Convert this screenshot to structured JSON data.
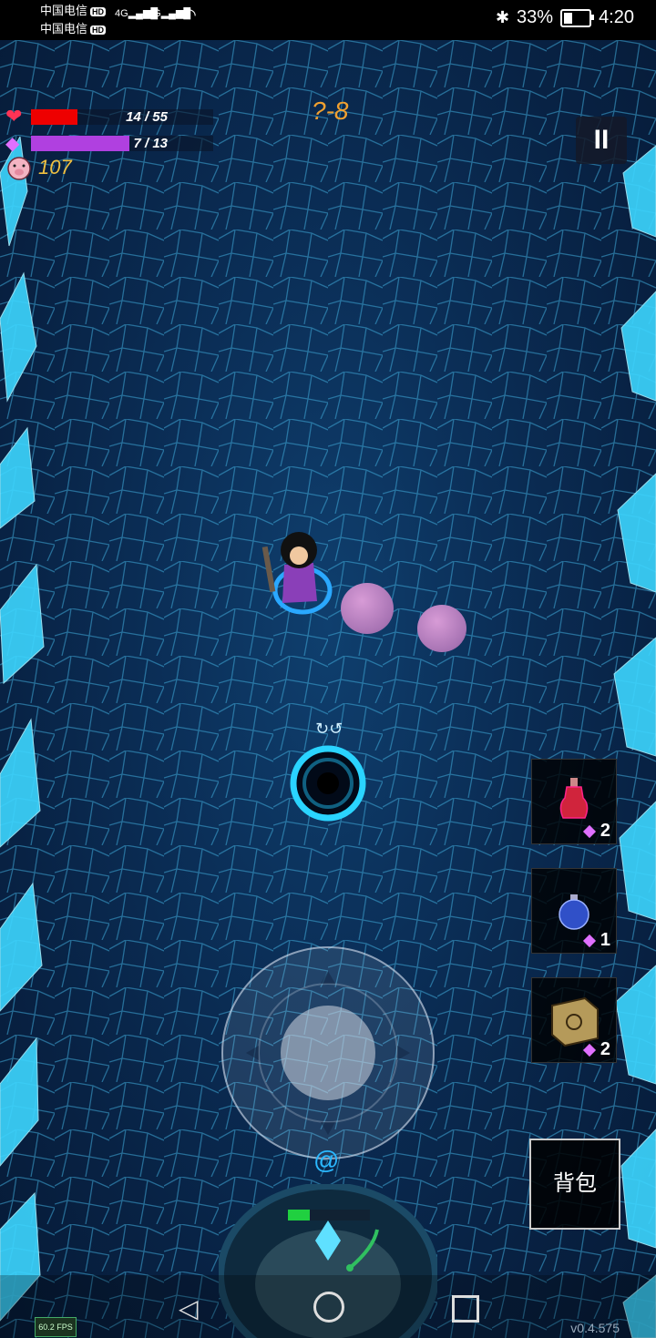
{
  "status_bar": {
    "carrier1": "中国电信",
    "carrier2": "中国电信",
    "hd": "HD",
    "network": "4G",
    "battery_percent": "33%",
    "battery_level": 0.33,
    "time": "4:20"
  },
  "hud": {
    "hp_text": "14 / 55",
    "hp_fraction": 0.2545,
    "hp_color": "#ee0000",
    "mana_text": "7 / 13",
    "mana_fraction": 0.538,
    "mana_color": "#b040e0",
    "gold": "107",
    "level": "?-8",
    "pause_label": "II"
  },
  "items": [
    {
      "name": "red-potion",
      "count": "2"
    },
    {
      "name": "blue-potion",
      "count": "1"
    },
    {
      "name": "rune-cube",
      "count": "2"
    }
  ],
  "bag_label": "背包",
  "fps": "60.2 FPS",
  "version": "v0.4.575"
}
